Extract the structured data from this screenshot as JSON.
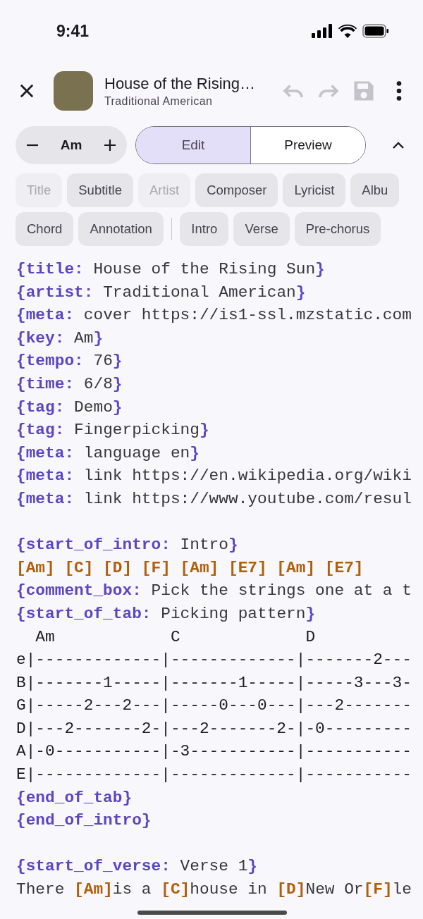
{
  "status_bar": {
    "time": "9:41"
  },
  "header": {
    "title": "House of the Rising…",
    "subtitle": "Traditional American",
    "actions": [
      {
        "kind": "undo",
        "disabled": true
      },
      {
        "kind": "redo",
        "disabled": true
      },
      {
        "kind": "save",
        "disabled": true
      },
      {
        "kind": "more",
        "disabled": false
      }
    ]
  },
  "key_stepper": {
    "value": "Am"
  },
  "mode_tabs": [
    {
      "label": "Edit",
      "selected": true
    },
    {
      "label": "Preview",
      "selected": false
    }
  ],
  "chip_rows": [
    [
      {
        "kind": "chip",
        "label": "Title",
        "disabled": true
      },
      {
        "kind": "chip",
        "label": "Subtitle",
        "disabled": false
      },
      {
        "kind": "chip",
        "label": "Artist",
        "disabled": true
      },
      {
        "kind": "chip",
        "label": "Composer",
        "disabled": false
      },
      {
        "kind": "chip",
        "label": "Lyricist",
        "disabled": false
      },
      {
        "kind": "chip",
        "label": "Albu",
        "disabled": false
      }
    ],
    [
      {
        "kind": "chip",
        "label": "Chord",
        "disabled": false
      },
      {
        "kind": "chip",
        "label": "Annotation",
        "disabled": false
      },
      {
        "kind": "divider"
      },
      {
        "kind": "chip",
        "label": "Intro",
        "disabled": false
      },
      {
        "kind": "chip",
        "label": "Verse",
        "disabled": false
      },
      {
        "kind": "chip",
        "label": "Pre-chorus",
        "disabled": false
      }
    ]
  ],
  "editor_lines": [
    {
      "kind": "code",
      "segments": [
        {
          "kind": "directive",
          "text": "{title:"
        },
        {
          "kind": "text",
          "text": " House of the Rising Sun"
        },
        {
          "kind": "directive",
          "text": "}"
        }
      ]
    },
    {
      "kind": "code",
      "segments": [
        {
          "kind": "directive",
          "text": "{artist:"
        },
        {
          "kind": "text",
          "text": " Traditional American"
        },
        {
          "kind": "directive",
          "text": "}"
        }
      ]
    },
    {
      "kind": "code",
      "segments": [
        {
          "kind": "directive",
          "text": "{meta:"
        },
        {
          "kind": "text",
          "text": " cover https://is1-ssl.mzstatic.com"
        }
      ]
    },
    {
      "kind": "code",
      "segments": [
        {
          "kind": "directive",
          "text": "{key:"
        },
        {
          "kind": "text",
          "text": " Am"
        },
        {
          "kind": "directive",
          "text": "}"
        }
      ]
    },
    {
      "kind": "code",
      "segments": [
        {
          "kind": "directive",
          "text": "{tempo:"
        },
        {
          "kind": "text",
          "text": " 76"
        },
        {
          "kind": "directive",
          "text": "}"
        }
      ]
    },
    {
      "kind": "code",
      "segments": [
        {
          "kind": "directive",
          "text": "{time:"
        },
        {
          "kind": "text",
          "text": " 6/8"
        },
        {
          "kind": "directive",
          "text": "}"
        }
      ]
    },
    {
      "kind": "code",
      "segments": [
        {
          "kind": "directive",
          "text": "{tag:"
        },
        {
          "kind": "text",
          "text": " Demo"
        },
        {
          "kind": "directive",
          "text": "}"
        }
      ]
    },
    {
      "kind": "code",
      "segments": [
        {
          "kind": "directive",
          "text": "{tag:"
        },
        {
          "kind": "text",
          "text": " Fingerpicking"
        },
        {
          "kind": "directive",
          "text": "}"
        }
      ]
    },
    {
      "kind": "code",
      "segments": [
        {
          "kind": "directive",
          "text": "{meta:"
        },
        {
          "kind": "text",
          "text": " language en"
        },
        {
          "kind": "directive",
          "text": "}"
        }
      ]
    },
    {
      "kind": "code",
      "segments": [
        {
          "kind": "directive",
          "text": "{meta:"
        },
        {
          "kind": "text",
          "text": " link https://en.wikipedia.org/wiki"
        }
      ]
    },
    {
      "kind": "code",
      "segments": [
        {
          "kind": "directive",
          "text": "{meta:"
        },
        {
          "kind": "text",
          "text": " link https://www.youtube.com/resul"
        }
      ]
    },
    {
      "kind": "blank"
    },
    {
      "kind": "code",
      "segments": [
        {
          "kind": "directive",
          "text": "{start_of_intro:"
        },
        {
          "kind": "text",
          "text": " Intro"
        },
        {
          "kind": "directive",
          "text": "}"
        }
      ]
    },
    {
      "kind": "code",
      "segments": [
        {
          "kind": "chord",
          "text": "[Am] [C] [D] [F] [Am] [E7] [Am] [E7]"
        }
      ]
    },
    {
      "kind": "code",
      "segments": [
        {
          "kind": "directive",
          "text": "{comment_box:"
        },
        {
          "kind": "text",
          "text": " Pick the strings one at a t"
        }
      ]
    },
    {
      "kind": "code",
      "segments": [
        {
          "kind": "directive",
          "text": "{start_of_tab:"
        },
        {
          "kind": "text",
          "text": " Picking pattern"
        },
        {
          "kind": "directive",
          "text": "}"
        }
      ]
    },
    {
      "kind": "code",
      "segments": [
        {
          "kind": "tab",
          "text": "  Am            C             D"
        }
      ]
    },
    {
      "kind": "code",
      "segments": [
        {
          "kind": "tab",
          "text": "e|-------------|-------------|-------2---"
        }
      ]
    },
    {
      "kind": "code",
      "segments": [
        {
          "kind": "tab",
          "text": "B|-------1-----|-------1-----|-----3---3-"
        }
      ]
    },
    {
      "kind": "code",
      "segments": [
        {
          "kind": "tab",
          "text": "G|-----2---2---|-----0---0---|---2-------"
        }
      ]
    },
    {
      "kind": "code",
      "segments": [
        {
          "kind": "tab",
          "text": "D|---2-------2-|---2-------2-|-0---------"
        }
      ]
    },
    {
      "kind": "code",
      "segments": [
        {
          "kind": "tab",
          "text": "A|-0-----------|-3-----------|-----------"
        }
      ]
    },
    {
      "kind": "code",
      "segments": [
        {
          "kind": "tab",
          "text": "E|-------------|-------------|-----------"
        }
      ]
    },
    {
      "kind": "code",
      "segments": [
        {
          "kind": "directive",
          "text": "{end_of_tab}"
        }
      ]
    },
    {
      "kind": "code",
      "segments": [
        {
          "kind": "directive",
          "text": "{end_of_intro}"
        }
      ]
    },
    {
      "kind": "blank"
    },
    {
      "kind": "code",
      "segments": [
        {
          "kind": "directive",
          "text": "{start_of_verse:"
        },
        {
          "kind": "text",
          "text": " Verse 1"
        },
        {
          "kind": "directive",
          "text": "}"
        }
      ]
    },
    {
      "kind": "code",
      "segments": [
        {
          "kind": "text",
          "text": "There "
        },
        {
          "kind": "chord",
          "text": "[Am]"
        },
        {
          "kind": "text",
          "text": "is a "
        },
        {
          "kind": "chord",
          "text": "[C]"
        },
        {
          "kind": "text",
          "text": "house in "
        },
        {
          "kind": "chord",
          "text": "[D]"
        },
        {
          "kind": "text",
          "text": "New Or"
        },
        {
          "kind": "chord",
          "text": "[F]"
        },
        {
          "kind": "text",
          "text": "le"
        }
      ]
    }
  ]
}
